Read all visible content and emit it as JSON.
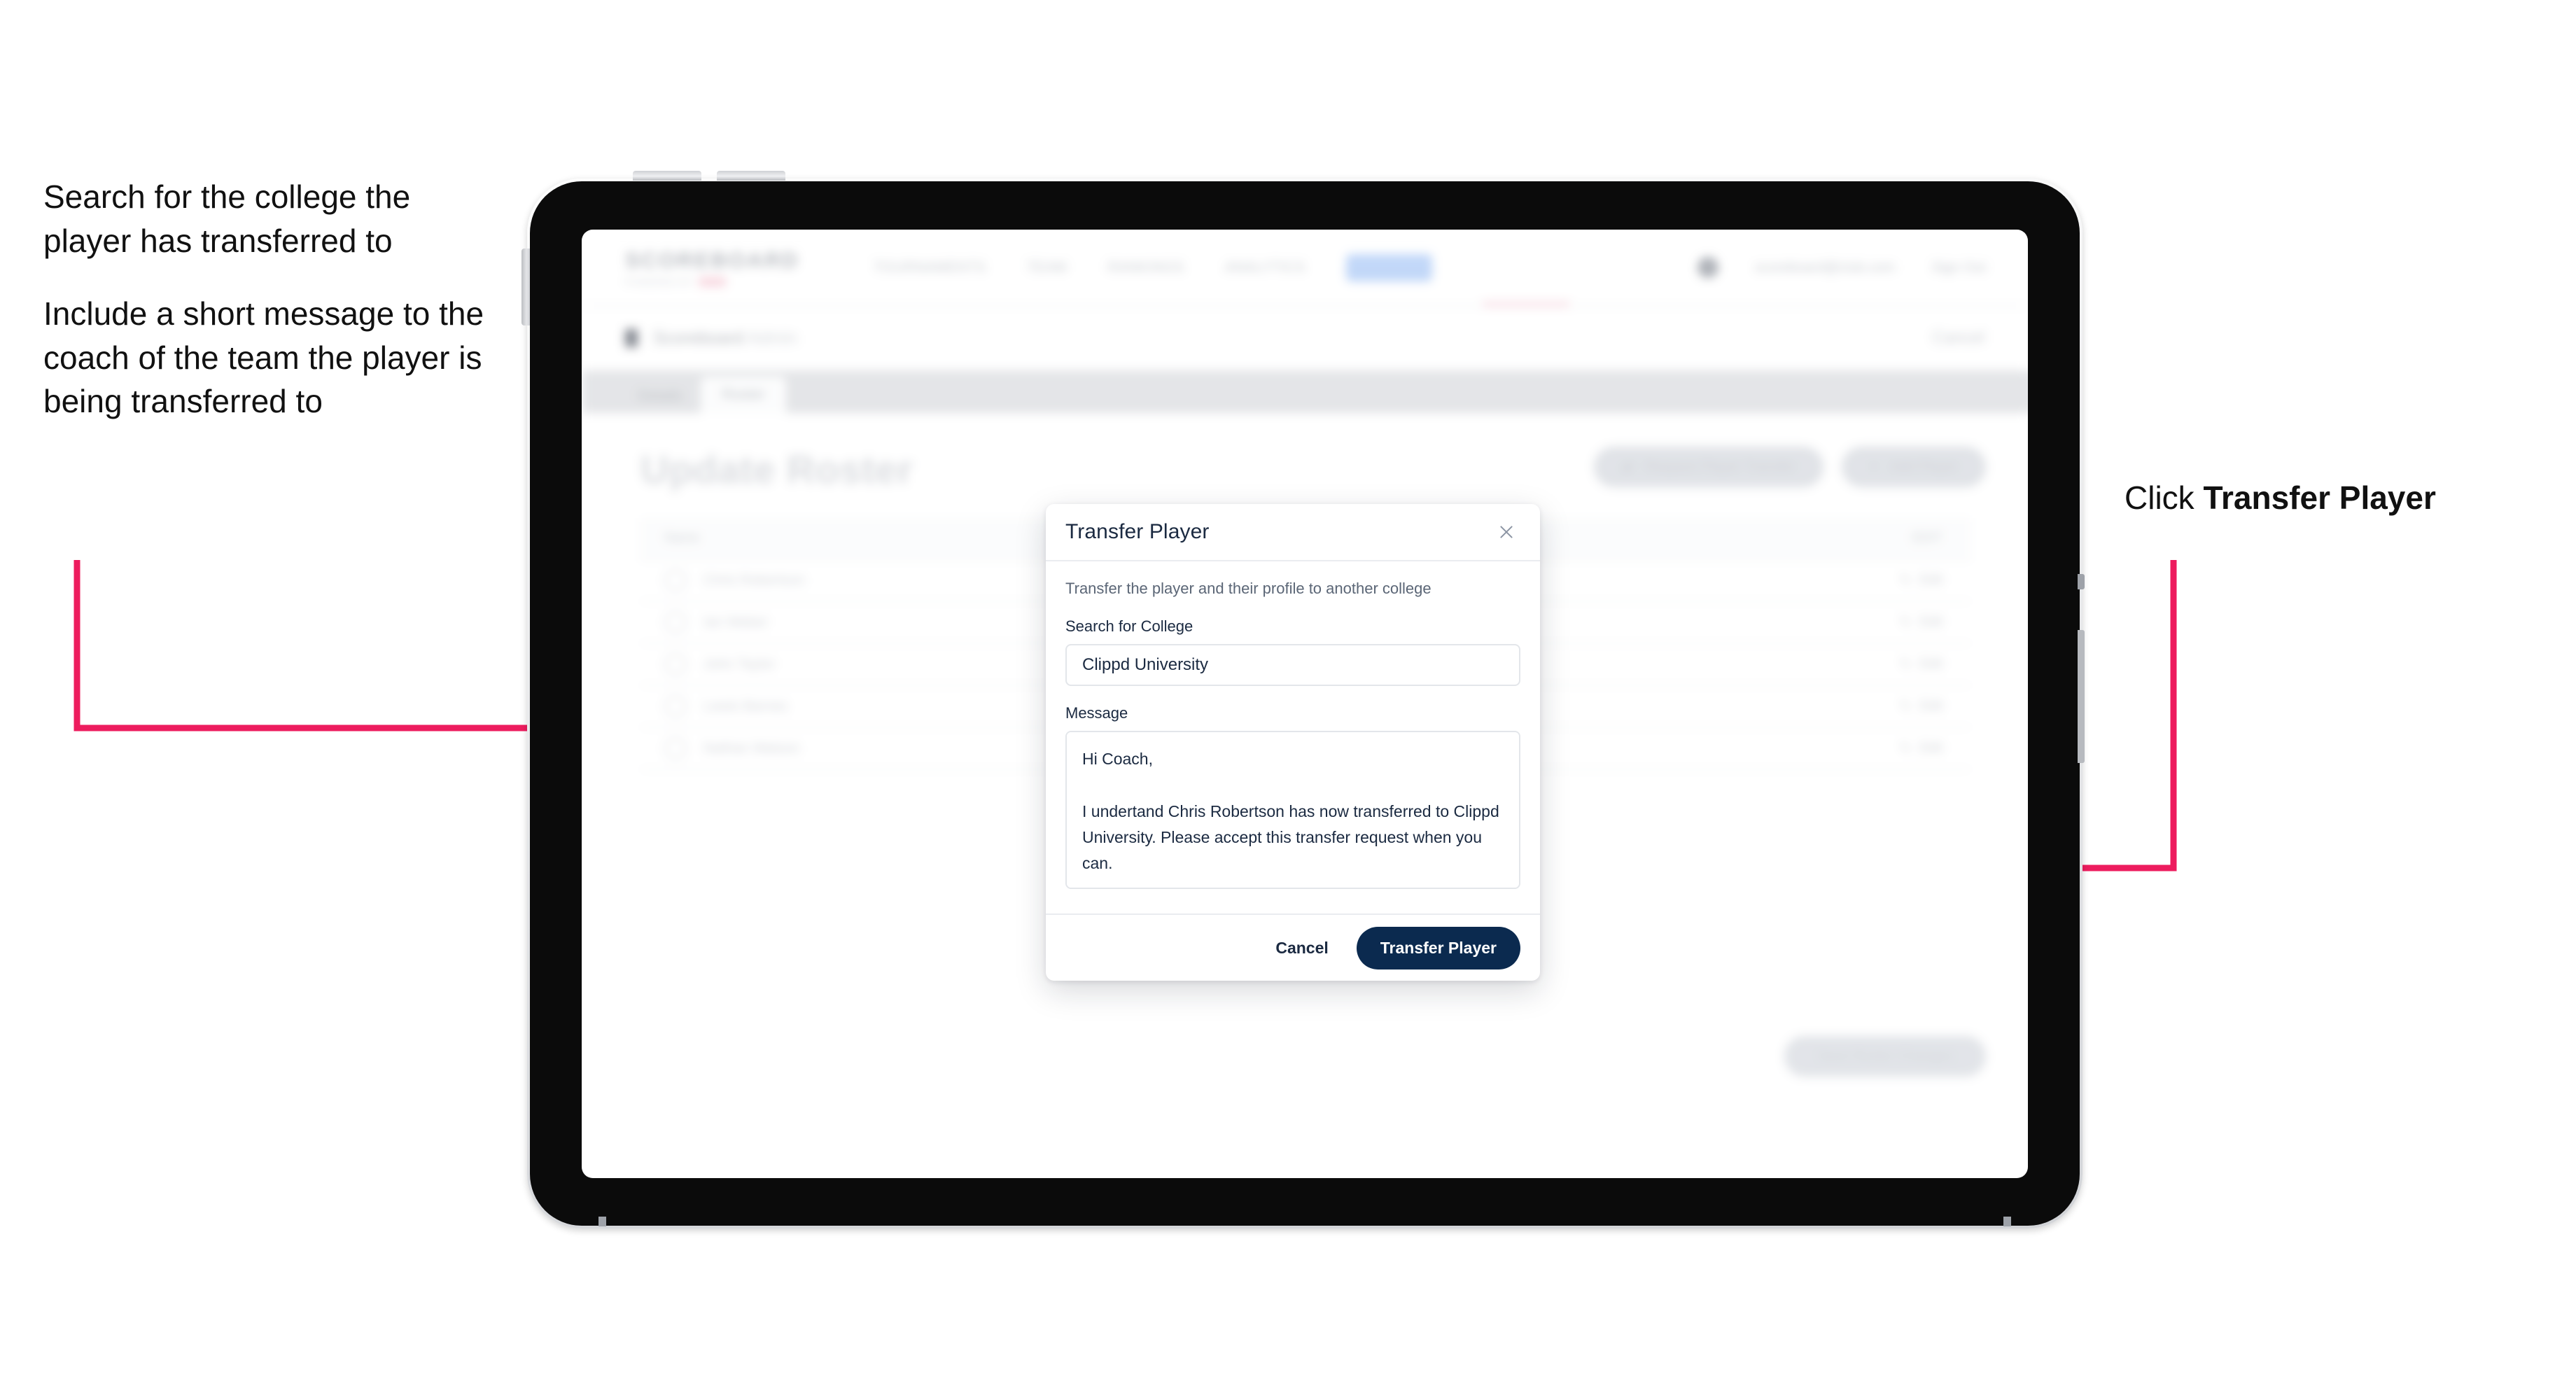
{
  "annotations": {
    "left": [
      "Search for the college the player has transferred to",
      "Include a short message to the coach of the team the player is being transferred to"
    ],
    "right_prefix": "Click ",
    "right_bold": "Transfer Player",
    "arrow_color": "#ed1c5e"
  },
  "device": {
    "name": "tablet-frame",
    "bezel_color": "#0b0b0b",
    "edge_color": "#d2d4d8"
  },
  "app": {
    "brand": {
      "name": "SCOREBOARD",
      "tagline": "POWERED BY",
      "tagline_badge": "xxx"
    },
    "topnav": [
      {
        "label": "TOURNAMENTS"
      },
      {
        "label": "TEAM"
      },
      {
        "label": "RANKINGS"
      },
      {
        "label": "ANALYTICS"
      },
      {
        "label": "ADMIN",
        "pill": true
      }
    ],
    "account": {
      "user": "scoreboard@club.com",
      "signout": "Sign Out"
    },
    "breadcrumb": {
      "title": "Scoreboard",
      "suffix": "Admin",
      "right": "Cancel"
    },
    "tabs": [
      {
        "label": "Details",
        "active": false
      },
      {
        "label": "Roster",
        "active": true
      }
    ],
    "page_title": "Update Roster",
    "actions": [
      {
        "icon": "request-icon",
        "label": "Request Player Transfer"
      },
      {
        "icon": "plus-icon",
        "label": "Add Player"
      }
    ],
    "table": {
      "columns": [
        "Name",
        "EDIT"
      ],
      "rows": [
        {
          "name": "Chris Robertson",
          "action": "Edit"
        },
        {
          "name": "Ian Weber",
          "action": "Edit"
        },
        {
          "name": "John Taylor",
          "action": "Edit"
        },
        {
          "name": "Lewis Barnes",
          "action": "Edit"
        },
        {
          "name": "Nathan Watson",
          "action": "Edit"
        }
      ]
    },
    "footer_button": "Save Roster Changes"
  },
  "modal": {
    "title": "Transfer Player",
    "close_icon": "close-icon",
    "subtitle": "Transfer the player and their profile to another college",
    "college_field": {
      "label": "Search for College",
      "value": "Clippd University",
      "placeholder": "Search for College"
    },
    "message_field": {
      "label": "Message",
      "value": "Hi Coach,\n\nI undertand Chris Robertson has now transferred to Clippd University. Please accept this transfer request when you can.",
      "placeholder": "Write a message"
    },
    "cancel_label": "Cancel",
    "submit_label": "Transfer Player",
    "submit_color": "#0b2a4f"
  }
}
